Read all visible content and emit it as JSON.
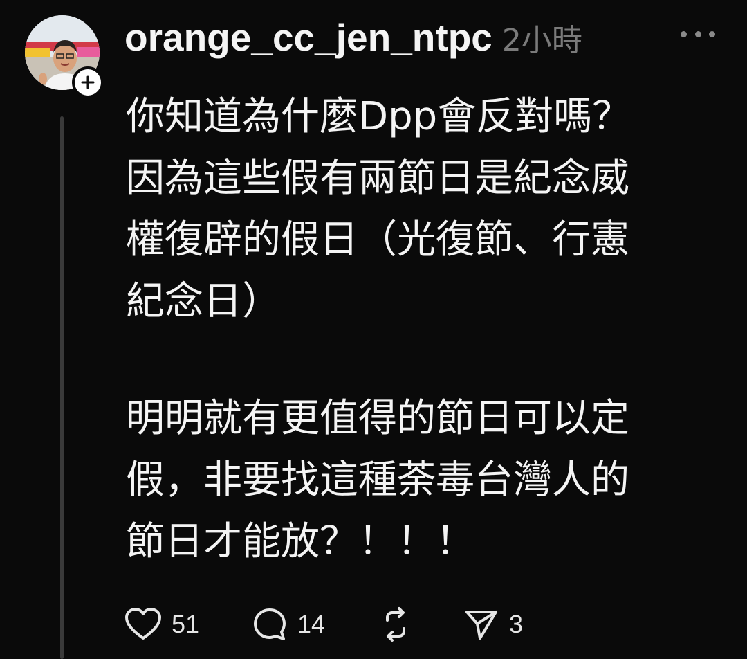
{
  "post": {
    "username": "orange_cc_jen_ntpc",
    "timestamp": "2小時",
    "paragraphs": [
      {
        "lines": [
          "你知道為什麼Dpp會反對嗎？",
          "因為這些假有兩節日是紀念威",
          "權復辟的假日（光復節、行憲",
          "紀念日）"
        ]
      },
      {
        "lines": [
          "明明就有更值得的節日可以定",
          "假，非要找這種荼毒台灣人的",
          "節日才能放？！！！"
        ]
      }
    ]
  },
  "actions": {
    "like": {
      "icon": "heart-icon",
      "count": "51"
    },
    "comment": {
      "icon": "comment-icon",
      "count": "14"
    },
    "repost": {
      "icon": "repost-icon"
    },
    "share": {
      "icon": "share-icon",
      "count": "3"
    }
  },
  "colors": {
    "background": "#0a0a0a",
    "text": "#f4f4f4",
    "muted": "#7a7a7a",
    "thread_line": "#3a3a3a"
  }
}
